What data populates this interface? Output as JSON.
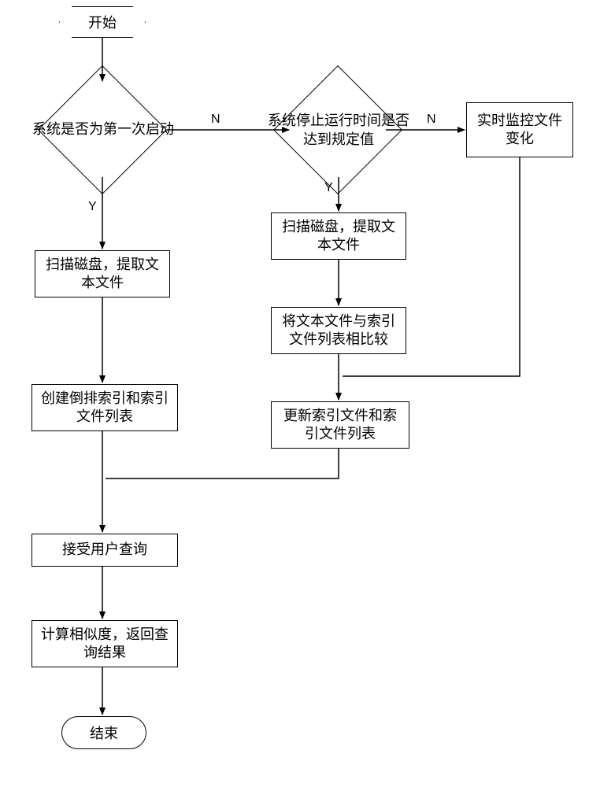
{
  "nodes": {
    "start": "开始",
    "d1": "系统是否为第一次启动",
    "d2": "系统停止运行时间是否\n达到规定值",
    "monitor": "实时监控文件\n变化",
    "scan_left": "扫描磁盘，提取文\n本文件",
    "create_index": "创建倒排索引和索引\n文件列表",
    "scan_right": "扫描磁盘，提取文\n本文件",
    "compare": "将文本文件与索引\n文件列表相比较",
    "update": "更新索引文件和索\n引文件列表",
    "accept": "接受用户查询",
    "calc": "计算相似度，返回查\n询结果",
    "end": "结束"
  },
  "labels": {
    "y": "Y",
    "n": "N"
  }
}
